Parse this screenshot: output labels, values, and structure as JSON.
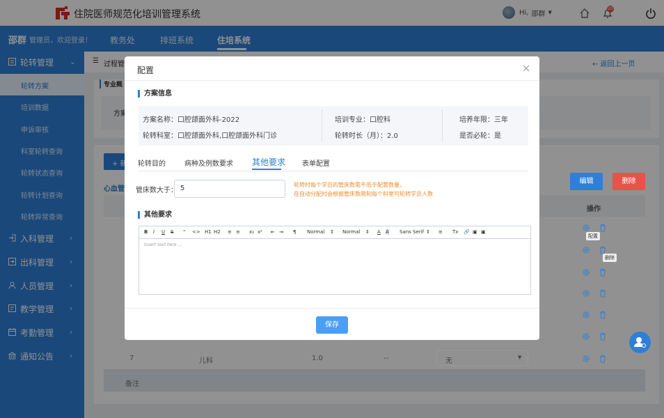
{
  "header": {
    "app_title": "住院医师规范化培训管理系统",
    "user_greeting": "Hi,",
    "user_name": "邵群",
    "notification_count": "20"
  },
  "nav": {
    "user": "邵群",
    "welcome": "管理员，欢迎登录！",
    "tabs": [
      "教务处",
      "排班系统",
      "住培系统"
    ],
    "active_tab": "住培系统"
  },
  "sidebar": {
    "groups": [
      {
        "label": "轮转管理",
        "icon": "list-icon"
      },
      {
        "label": "入科管理",
        "icon": "enter-icon"
      },
      {
        "label": "出科管理",
        "icon": "exit-icon"
      },
      {
        "label": "人员管理",
        "icon": "person-icon"
      },
      {
        "label": "教学管理",
        "icon": "teach-icon"
      },
      {
        "label": "考勤管理",
        "icon": "calendar-icon"
      },
      {
        "label": "通知公告",
        "icon": "bank-icon"
      }
    ],
    "sub_items": [
      "轮转方案",
      "培训数据",
      "申诉审核",
      "科室轮转查询",
      "轮转状态查询",
      "轮转计划查询",
      "轮转异常查询"
    ]
  },
  "background": {
    "breadcrumb": "过程管",
    "back_link": "← 返回上一页",
    "section": "专业概",
    "plan_label": "方案",
    "add_button": "+ 新",
    "table_tab": "心血管",
    "edit_button": "编辑",
    "delete_button": "删除",
    "ops_header": "操作",
    "row7": {
      "no": "7",
      "dept": "儿科",
      "duration": "1.0",
      "dash": "--",
      "select": "无"
    },
    "remark": "备注",
    "tooltip_config": "配置",
    "tooltip_delete": "删除"
  },
  "modal": {
    "title": "配置",
    "plan_info_title": "方案信息",
    "info": {
      "plan_name": "方案名称：口腔颌面外科-2022",
      "specialty": "培训专业：口腔科",
      "years": "培养年限：三年",
      "rotation_depts": "轮转科室：口腔颌面外科,口腔颌面外科门诊",
      "duration": "轮转时长（月）：2.0",
      "required": "是否必轮：是"
    },
    "tabs": [
      "轮转目的",
      "病种及例数要求",
      "其他要求",
      "表单配置"
    ],
    "active_tab": "其他要求",
    "beds_label": "管床数大于：",
    "beds_value": "5",
    "hint_line1": "轮转时每个学员的管床数需不低于配置数量，",
    "hint_line2": "在自动分配时会根据管床数限制每个科室可轮转学员人数",
    "other_req_title": "其他要求",
    "editor": {
      "toolbar": [
        "B",
        "I",
        "U",
        "S",
        "\"",
        "<>",
        "H1",
        "H2",
        "≡",
        "≡",
        "x₂",
        "x²",
        "⇤",
        "⇥",
        "¶",
        "Normal",
        "Normal",
        "A",
        "A",
        "Sans Serif",
        "≡",
        "Tx",
        "🔗",
        "▣",
        "▣"
      ],
      "placeholder": "Insert text here ..."
    },
    "save_button": "保存"
  }
}
